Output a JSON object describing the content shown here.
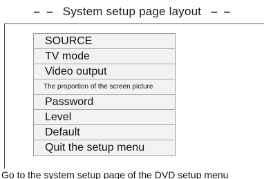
{
  "header": {
    "dash_left": "– –",
    "title": "System setup page layout",
    "dash_right": "– –"
  },
  "menu": {
    "items": [
      {
        "label": "SOURCE"
      },
      {
        "label": "TV mode"
      },
      {
        "label": "Video output"
      },
      {
        "label": "The proportion of the screen picture"
      },
      {
        "label": "Password"
      },
      {
        "label": "Level"
      },
      {
        "label": "Default"
      },
      {
        "label": "Quit the setup menu"
      }
    ]
  },
  "footer": {
    "caption": "Go to the system setup page of the DVD setup menu"
  }
}
